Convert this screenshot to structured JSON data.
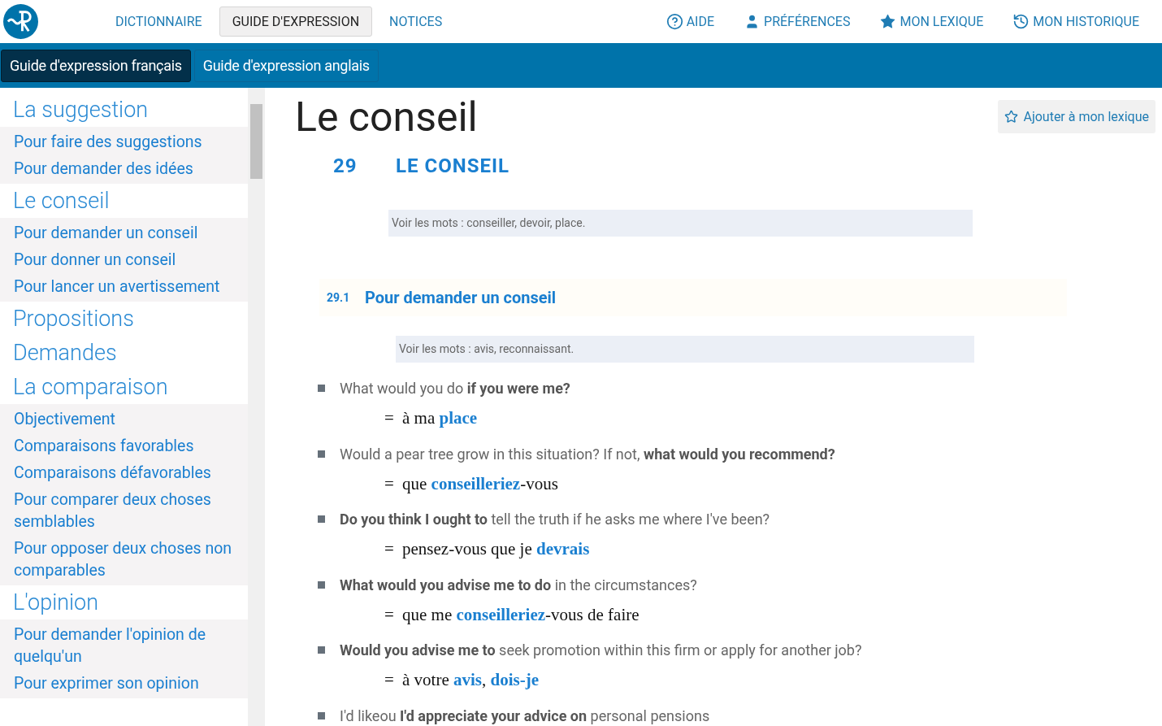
{
  "header": {
    "nav": [
      {
        "label": "DICTIONNAIRE",
        "selected": false
      },
      {
        "label": "GUIDE D'EXPRESSION",
        "selected": true
      },
      {
        "label": "NOTICES",
        "selected": false
      }
    ],
    "links": [
      {
        "kind": "help",
        "label": "AIDE"
      },
      {
        "kind": "user",
        "label": "PRÉFÉRENCES"
      },
      {
        "kind": "star",
        "label": "MON LEXIQUE"
      },
      {
        "kind": "history",
        "label": "MON HISTORIQUE"
      }
    ]
  },
  "subnav": [
    {
      "label": "Guide d'expression français",
      "selected": true
    },
    {
      "label": "Guide d'expression anglais",
      "selected": false
    }
  ],
  "sidebar": [
    {
      "title": "La suggestion",
      "children": [
        "Pour faire des suggestions",
        "Pour demander des idées"
      ]
    },
    {
      "title": "Le conseil",
      "children": [
        "Pour demander un conseil",
        "Pour donner un conseil",
        "Pour lancer un avertissement"
      ]
    },
    {
      "title": "Propositions"
    },
    {
      "title": "Demandes"
    },
    {
      "title": "La comparaison",
      "children": [
        "Objectivement",
        "Comparaisons favorables",
        "Comparaisons défavorables",
        "Pour comparer deux choses semblables",
        "Pour opposer deux choses non comparables"
      ]
    },
    {
      "title": "L'opinion",
      "children": [
        "Pour demander l'opinion de quelqu'un",
        "Pour exprimer son opinion"
      ]
    }
  ],
  "page": {
    "title": "Le conseil",
    "add_button": "Ajouter à mon lexique",
    "chapter_number": "29",
    "chapter_title": "LE CONSEIL",
    "see_also": "Voir les mots : conseiller, devoir, place.",
    "section_number": "29.1",
    "section_title": "Pour demander un conseil",
    "section_see_also": "Voir les mots : avis, reconnaissant.",
    "examples": [
      {
        "en": "What would you do **if you were me?**",
        "eq": "=",
        "fr": "à ma **place**"
      },
      {
        "en": "Would a pear tree grow in this situation? If not, **what would you recommend?**",
        "eq": "=",
        "fr": "que **conseilleriez**-vous"
      },
      {
        "en": "**Do you think I ought to** tell the truth if he asks me where I've been?",
        "eq": "=",
        "fr": "pensez-vous que je **devrais**"
      },
      {
        "en": "**What would you advise me to do** in the circumstances?",
        "eq": "=",
        "fr": "que me **conseilleriez**-vous de faire"
      },
      {
        "en": "**Would you advise me to** seek promotion within this firm or apply for another job?",
        "eq": "=",
        "fr": "à votre **avis**, **dois-je**"
      },
      {
        "en": "I'd likeou **I'd appreciate your advice on** personal pensions"
      }
    ]
  }
}
